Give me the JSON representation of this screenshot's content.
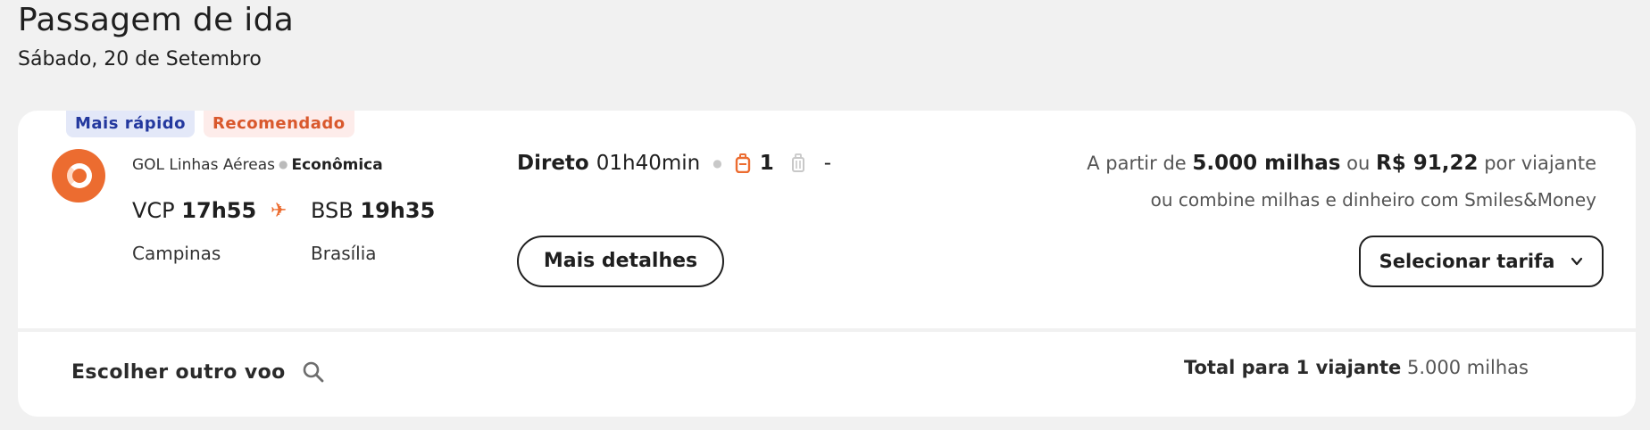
{
  "header": {
    "title": "Passagem de ida",
    "date": "Sábado, 20 de Setembro"
  },
  "flight": {
    "badges": {
      "fastest": "Mais rápido",
      "recommended": "Recomendado"
    },
    "airline": "GOL Linhas Aéreas",
    "cabin": "Econômica",
    "origin": {
      "code": "VCP",
      "time": "17h55",
      "city": "Campinas"
    },
    "destination": {
      "code": "BSB",
      "time": "19h35",
      "city": "Brasília"
    },
    "stops_label": "Direto",
    "duration": "01h40min",
    "carry_on_count": "1",
    "checked_bag": "-",
    "details_button": "Mais detalhes",
    "price": {
      "prefix": "A partir de",
      "miles": "5.000 milhas",
      "or": "ou",
      "money": "R$ 91,22",
      "suffix": "por viajante",
      "smiles_money": "ou combine milhas e dinheiro com Smiles&Money"
    },
    "select_button": "Selecionar tarifa"
  },
  "footer": {
    "other_flight": "Escolher outro voo",
    "total_label": "Total para 1 viajante",
    "total_value": "5.000 milhas"
  },
  "colors": {
    "brand_orange": "#ec6c30",
    "badge_fast_bg": "#e3e8f8",
    "badge_fast_text": "#23389e",
    "badge_rec_bg": "#fdecea",
    "badge_rec_text": "#d9582c"
  }
}
